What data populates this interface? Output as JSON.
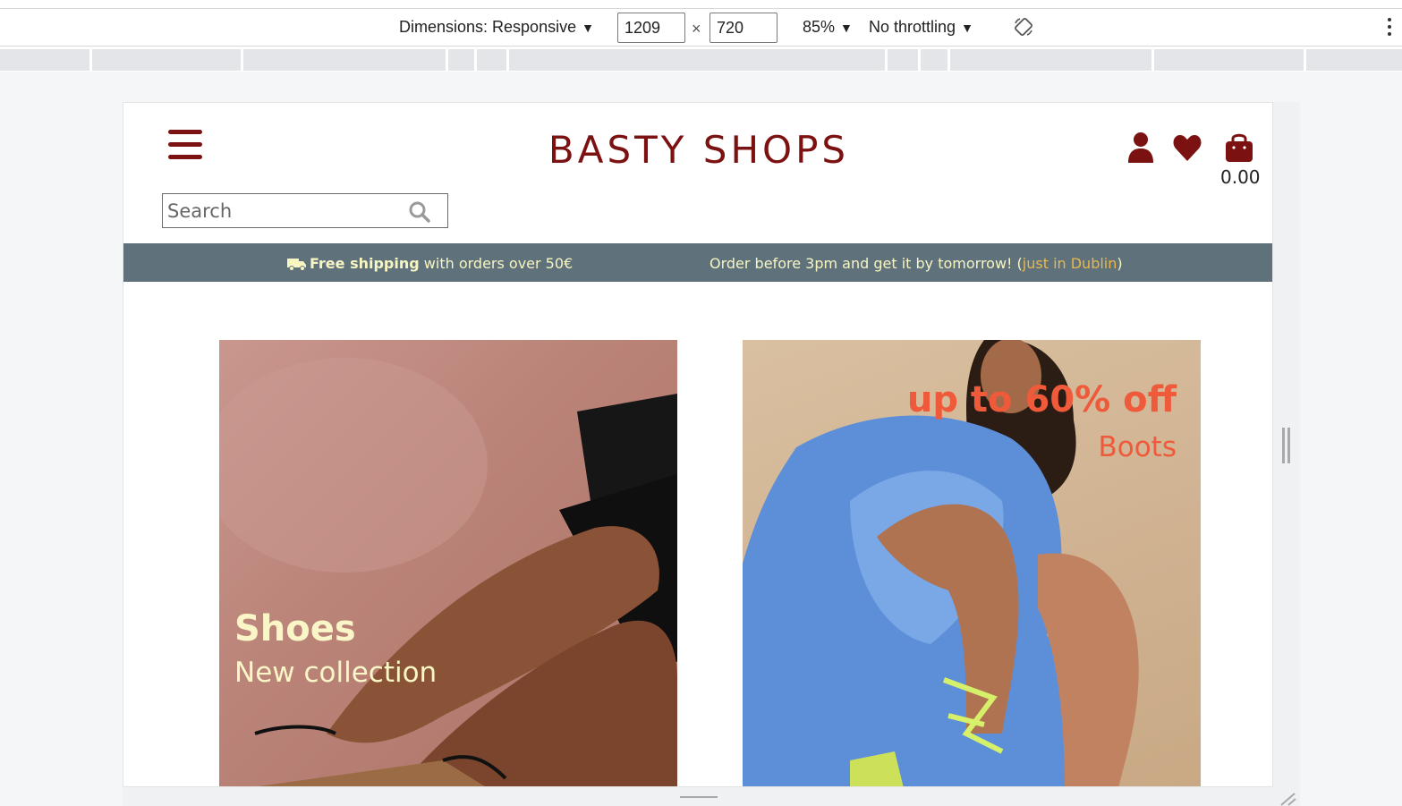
{
  "devtools": {
    "dimensions_label": "Dimensions: Responsive",
    "width_value": "1209",
    "height_value": "720",
    "times": "×",
    "zoom": "85%",
    "throttling": "No throttling",
    "caret": "▼"
  },
  "site": {
    "logo": "BASTY SHOPS",
    "search": {
      "placeholder": "Search",
      "value": ""
    },
    "cart_total": "0.00",
    "icons": [
      "menu-icon",
      "user-icon",
      "heart-icon",
      "shopping-bag-icon",
      "search-icon",
      "truck-icon"
    ],
    "shipping": {
      "left_bold": "Free shipping",
      "left_text": " with orders over 50€",
      "right_text": "Order before 3pm and get it by tomorrow! (",
      "right_highlight": "just in Dublin",
      "right_end": ")"
    },
    "promos": [
      {
        "title": "Shoes",
        "subtitle": "New collection"
      },
      {
        "title": "up to 60% off",
        "subtitle": "Boots"
      }
    ],
    "colors": {
      "brand": "#7b1111",
      "bar": "#5f727c",
      "bar_text": "#f7f5c2",
      "highlight": "#e8b84a",
      "promo_accent": "#ee5a3a"
    }
  }
}
